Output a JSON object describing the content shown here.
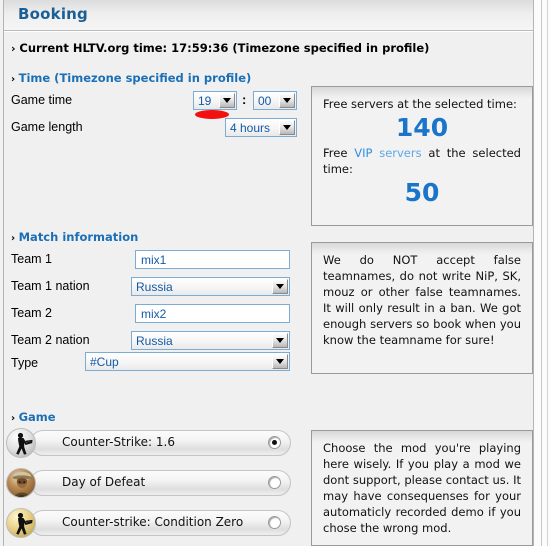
{
  "header": {
    "title": "Booking"
  },
  "status": {
    "current_time_line": "Current HLTV.org time: 17:59:36 (Timezone specified in profile)"
  },
  "sections": {
    "time": {
      "heading": "Time (Timezone specified in profile)"
    },
    "match": {
      "heading": "Match information"
    },
    "game": {
      "heading": "Game"
    }
  },
  "time_form": {
    "game_time_label": "Game time",
    "game_time_hour": "19",
    "game_time_separator": ":",
    "game_time_minute": "00",
    "game_length_label": "Game length",
    "game_length_value": "4 hours"
  },
  "match_form": {
    "team1_label": "Team 1",
    "team1_value": "mix1",
    "team1_nation_label": "Team 1 nation",
    "team1_nation_value": "Russia",
    "team2_label": "Team 2",
    "team2_value": "mix2",
    "team2_nation_label": "Team 2 nation",
    "team2_nation_value": "Russia",
    "type_label": "Type",
    "type_value": "#Cup"
  },
  "servers_panel": {
    "free_servers_text": "Free servers at the selected time:",
    "free_servers_count": "140",
    "vip_prefix": "Free ",
    "vip_link_a": "VIP",
    "vip_link_b": " servers",
    "vip_suffix": " at the selected time:",
    "vip_servers_count": "50"
  },
  "teamname_panel": {
    "text": "We do NOT accept false teamnames, do not write NiP, SK, mouz or other false teamnames. It will only result in a ban. We got enough servers so book when you know the teamname for sure!"
  },
  "mod_panel": {
    "text": "Choose the mod you're playing here wisely. If you play a mod we dont support, please contact us. It may have consequenses for your automaticly recorded demo if you chose the wrong mod."
  },
  "games": [
    {
      "label": "Counter-Strike: 1.6",
      "icon": "counter-strike-silhouette-icon",
      "selected": true
    },
    {
      "label": "Day of Defeat",
      "icon": "soldier-portrait-icon",
      "selected": false
    },
    {
      "label": "Counter-strike: Condition Zero",
      "icon": "counter-strike-silhouette-icon",
      "selected": false
    }
  ],
  "colors": {
    "accent_blue": "#1b6fb5",
    "value_blue": "#1459a8",
    "big_number_blue": "#1a74c9",
    "annotation_red": "#f21010"
  }
}
